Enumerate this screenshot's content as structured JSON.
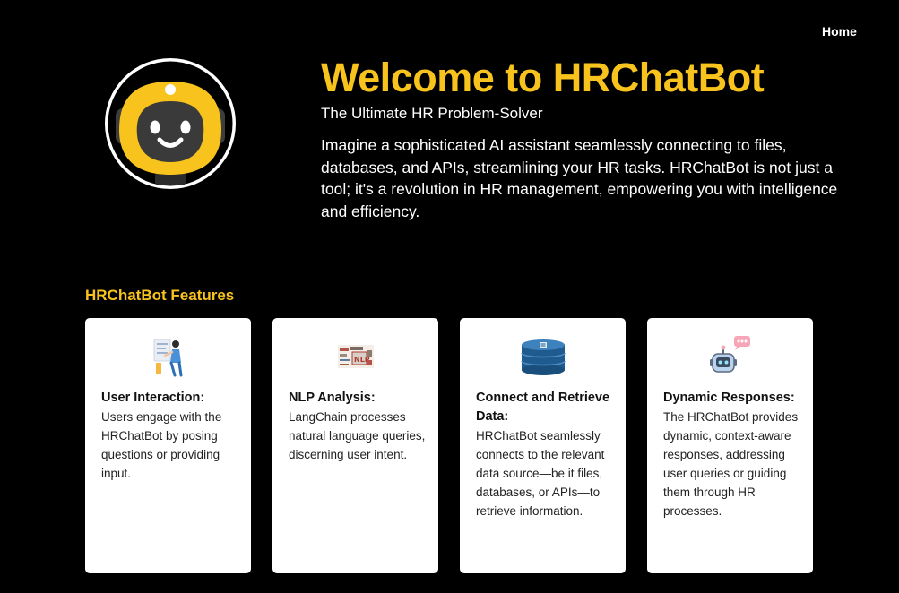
{
  "nav": {
    "home_label": "Home"
  },
  "hero": {
    "title": "Welcome to HRChatBot",
    "subtitle": "The Ultimate HR Problem-Solver",
    "description": "Imagine a sophisticated AI assistant seamlessly connecting to files, databases, and APIs, streamlining your HR tasks. HRChatBot is not just a tool; it's a revolution in HR management, empowering you with intelligence and efficiency."
  },
  "features": {
    "heading": "HRChatBot Features",
    "cards": [
      {
        "icon": "user-interaction-icon",
        "title": "User Interaction:",
        "text": "Users engage with the HRChatBot by posing questions or providing input."
      },
      {
        "icon": "nlp-word-cloud-icon",
        "title": "NLP Analysis:",
        "text": "LangChain processes natural language queries, discerning user intent."
      },
      {
        "icon": "database-icon",
        "title": "Connect and Retrieve Data:",
        "text": "HRChatBot seamlessly connects to the relevant data source—be it files, databases, or APIs—to retrieve information."
      },
      {
        "icon": "robot-chat-icon",
        "title": "Dynamic Responses:",
        "text": "The HRChatBot provides dynamic, context-aware responses, addressing user queries or guiding them through HR processes."
      }
    ]
  },
  "colors": {
    "background": "#000000",
    "accent": "#f7c31c",
    "card": "#ffffff"
  }
}
